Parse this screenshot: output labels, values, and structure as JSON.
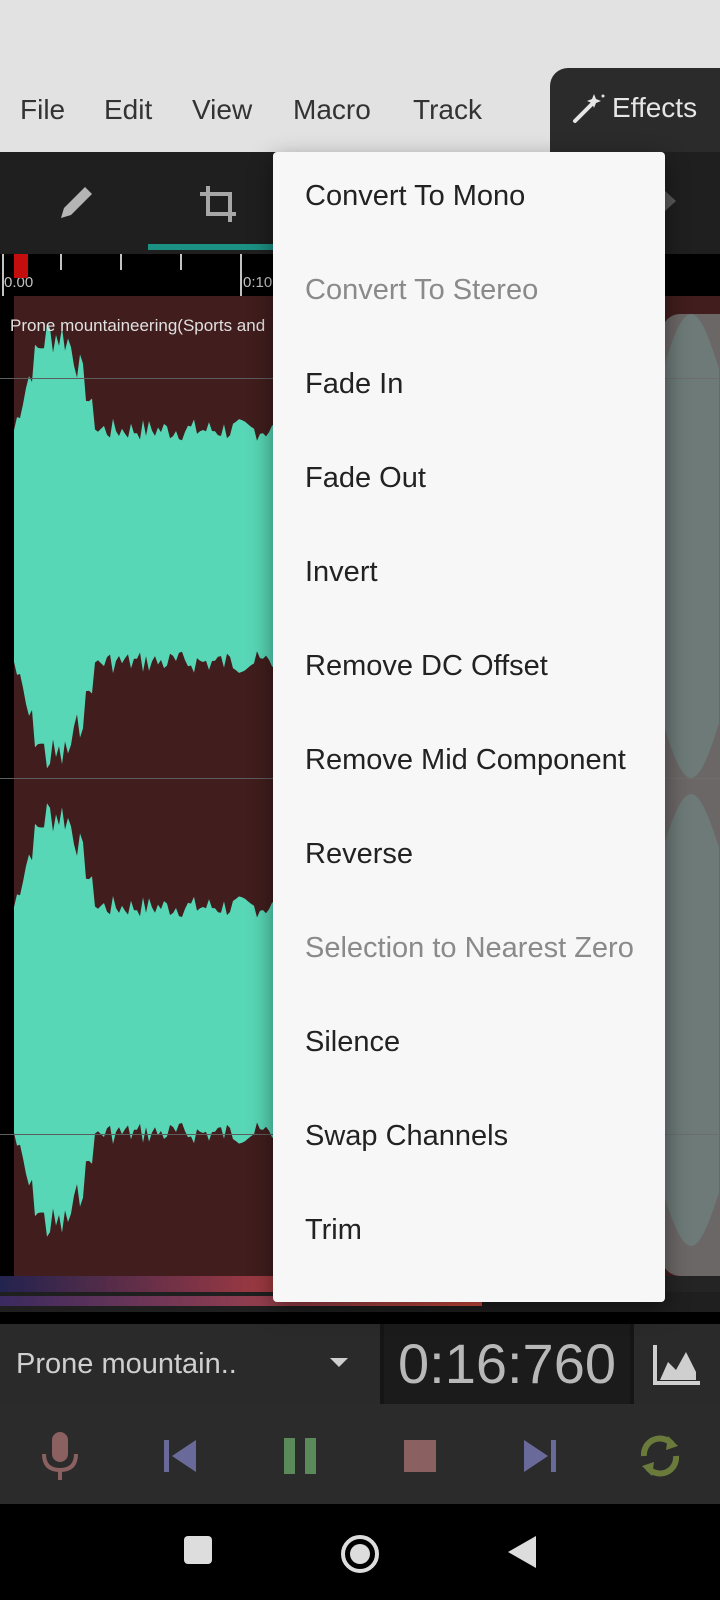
{
  "menubar": {
    "items": [
      "File",
      "Edit",
      "View",
      "Macro",
      "Track"
    ],
    "effects_label": "Effects"
  },
  "toolbar": {
    "tools": [
      "pencil-icon",
      "crop-icon"
    ]
  },
  "waveform": {
    "timeline_labels": [
      "0.00",
      "0:10"
    ],
    "track_title": "Prone mountaineering(Sports and",
    "color": "#63f5d0",
    "background": "#4a2222"
  },
  "player": {
    "file_name": "Prone mountain..",
    "time": "0:16:760",
    "progress": 0.67
  },
  "transport": {
    "buttons": [
      "mic-icon",
      "skip-back-icon",
      "pause-icon",
      "stop-icon",
      "skip-forward-icon",
      "loop-icon"
    ]
  },
  "effects_menu": {
    "items": [
      {
        "label": "Convert To Mono",
        "enabled": true
      },
      {
        "label": "Convert To Stereo",
        "enabled": false
      },
      {
        "label": "Fade In",
        "enabled": true
      },
      {
        "label": "Fade Out",
        "enabled": true
      },
      {
        "label": "Invert",
        "enabled": true
      },
      {
        "label": "Remove DC Offset",
        "enabled": true
      },
      {
        "label": "Remove Mid Component",
        "enabled": true
      },
      {
        "label": "Reverse",
        "enabled": true
      },
      {
        "label": "Selection to Nearest Zero",
        "enabled": false
      },
      {
        "label": "Silence",
        "enabled": true
      },
      {
        "label": "Swap Channels",
        "enabled": true
      },
      {
        "label": "Trim",
        "enabled": true
      }
    ]
  }
}
